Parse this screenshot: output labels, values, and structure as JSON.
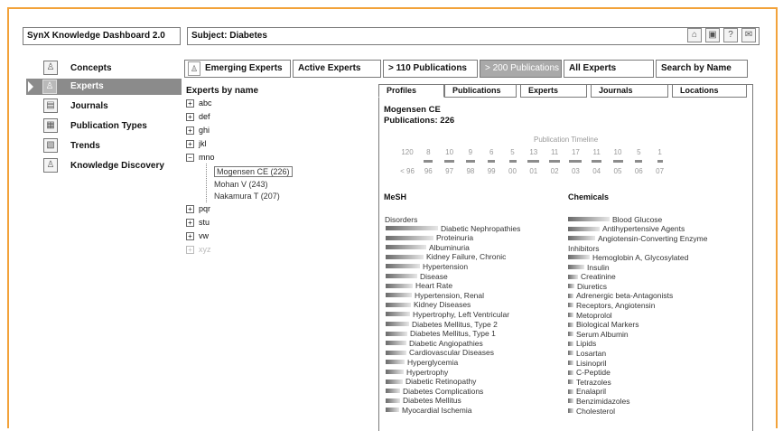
{
  "header": {
    "app_title": "SynX Knowledge Dashboard 2.0",
    "subject": "Subject: Diabetes",
    "toolbar_icons": [
      "home-icon",
      "monitor-icon",
      "help-icon",
      "mail-icon"
    ],
    "toolbar_glyphs": [
      "⌂",
      "▣",
      "?",
      "✉"
    ]
  },
  "sidebar": {
    "items": [
      {
        "label": "Concepts",
        "icon": "concepts-icon",
        "glyph": "♙"
      },
      {
        "label": "Experts",
        "icon": "experts-icon",
        "glyph": "♙"
      },
      {
        "label": "Journals",
        "icon": "journals-icon",
        "glyph": "▤"
      },
      {
        "label": "Publication Types",
        "icon": "publication-types-icon",
        "glyph": "▦"
      },
      {
        "label": "Trends",
        "icon": "trends-icon",
        "glyph": "▧"
      },
      {
        "label": "Knowledge Discovery",
        "icon": "knowledge-discovery-icon",
        "glyph": "♙"
      }
    ]
  },
  "tabs": {
    "emerging_icon": "♙",
    "items": [
      "Emerging Experts",
      "Active Experts",
      "> 110 Publications",
      "> 200 Publications",
      "All Experts",
      "Search by Name"
    ]
  },
  "tree": {
    "title": "Experts by name",
    "groups": [
      "abc",
      "def",
      "ghi",
      "jkl",
      "mno",
      "pqr",
      "stu",
      "vw",
      "xyz"
    ],
    "mno_children": [
      "Mogensen CE (226)",
      "Mohan V (243)",
      "Nakamura T (207)"
    ],
    "expand_glyph": "+",
    "collapse_glyph": "−"
  },
  "detail": {
    "tabs": [
      "Profiles",
      "Publications",
      "Experts",
      "Journals",
      "Locations"
    ],
    "name": "Mogensen CE",
    "publications": "Publications: 226",
    "timeline_title": "Publication Timeline",
    "timeline": [
      {
        "count": "120",
        "year": "< 96",
        "value": 120
      },
      {
        "count": "8",
        "year": "96",
        "value": 8
      },
      {
        "count": "10",
        "year": "97",
        "value": 10
      },
      {
        "count": "9",
        "year": "98",
        "value": 9
      },
      {
        "count": "6",
        "year": "99",
        "value": 6
      },
      {
        "count": "5",
        "year": "00",
        "value": 5
      },
      {
        "count": "13",
        "year": "01",
        "value": 13
      },
      {
        "count": "11",
        "year": "02",
        "value": 11
      },
      {
        "count": "17",
        "year": "03",
        "value": 17
      },
      {
        "count": "11",
        "year": "04",
        "value": 11
      },
      {
        "count": "10",
        "year": "05",
        "value": 10
      },
      {
        "count": "5",
        "year": "06",
        "value": 5
      },
      {
        "count": "1",
        "year": "07",
        "value": 1
      }
    ],
    "mesh_title": "MeSH",
    "mesh_group": "Disorders",
    "mesh_terms": [
      {
        "label": "Diabetic Nephropathies",
        "weight": 1.0
      },
      {
        "label": "Proteinuria",
        "weight": 0.92
      },
      {
        "label": "Albuminuria",
        "weight": 0.78
      },
      {
        "label": "Kidney Failure, Chronic",
        "weight": 0.72
      },
      {
        "label": "Hypertension",
        "weight": 0.66
      },
      {
        "label": "Disease",
        "weight": 0.6
      },
      {
        "label": "Heart Rate",
        "weight": 0.52
      },
      {
        "label": "Hypertension, Renal",
        "weight": 0.5
      },
      {
        "label": "Kidney Diseases",
        "weight": 0.48
      },
      {
        "label": "Hypertrophy, Left Ventricular",
        "weight": 0.46
      },
      {
        "label": "Diabetes Mellitus, Type 2",
        "weight": 0.45
      },
      {
        "label": "Diabetes Mellitus, Type 1",
        "weight": 0.42
      },
      {
        "label": "Diabetic Angiopathies",
        "weight": 0.4
      },
      {
        "label": "Cardiovascular Diseases",
        "weight": 0.4
      },
      {
        "label": "Hyperglycemia",
        "weight": 0.37
      },
      {
        "label": "Hypertrophy",
        "weight": 0.35
      },
      {
        "label": "Diabetic Retinopathy",
        "weight": 0.32
      },
      {
        "label": "Diabetes Complications",
        "weight": 0.28
      },
      {
        "label": "Diabetes Mellitus",
        "weight": 0.27
      },
      {
        "label": "Myocardial Ischemia",
        "weight": 0.26
      }
    ],
    "chem_title": "Chemicals",
    "chem_group": "Inhibitors",
    "chem_terms_pre": [
      {
        "label": "Blood Glucose",
        "weight": 1.0
      },
      {
        "label": "Antihypertensive Agents",
        "weight": 0.75
      },
      {
        "label": "Angiotensin-Converting Enzyme",
        "weight": 0.66
      }
    ],
    "chem_terms_post": [
      {
        "label": "Hemoglobin A, Glycosylated",
        "weight": 0.66
      },
      {
        "label": "Insulin",
        "weight": 0.5
      },
      {
        "label": "Creatinine",
        "weight": 0.3
      },
      {
        "label": "Diuretics",
        "weight": 0.2
      },
      {
        "label": "Adrenergic beta-Antagonists",
        "weight": 0.18
      },
      {
        "label": "Receptors, Angiotensin",
        "weight": 0.18
      },
      {
        "label": "Metoprolol",
        "weight": 0.15
      },
      {
        "label": "Biological Markers",
        "weight": 0.15
      },
      {
        "label": "Serum Albumin",
        "weight": 0.15
      },
      {
        "label": "Lipids",
        "weight": 0.14
      },
      {
        "label": "Losartan",
        "weight": 0.14
      },
      {
        "label": "Lisinopril",
        "weight": 0.14
      },
      {
        "label": "C-Peptide",
        "weight": 0.14
      },
      {
        "label": "Tetrazoles",
        "weight": 0.14
      },
      {
        "label": "Enalapril",
        "weight": 0.14
      },
      {
        "label": "Benzimidazoles",
        "weight": 0.14
      },
      {
        "label": "Cholesterol",
        "weight": 0.14
      }
    ]
  }
}
